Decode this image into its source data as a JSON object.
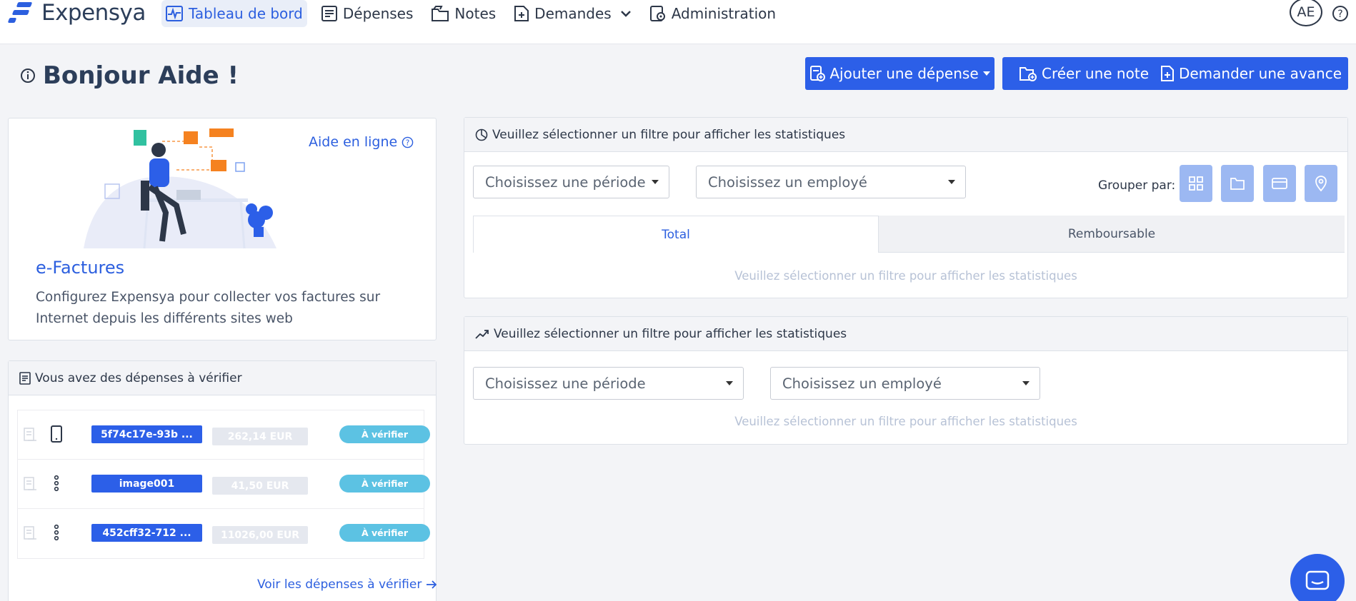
{
  "app": {
    "name": "Expensya"
  },
  "nav": {
    "items": [
      {
        "label": "Tableau de bord",
        "icon": "pulse-chart-icon",
        "active": true
      },
      {
        "label": "Dépenses",
        "icon": "receipt-icon",
        "active": false
      },
      {
        "label": "Notes",
        "icon": "folder-icon",
        "active": false
      },
      {
        "label": "Demandes",
        "icon": "file-plus-icon",
        "active": false,
        "dropdown": true
      },
      {
        "label": "Administration",
        "icon": "gear-doc-icon",
        "active": false
      }
    ],
    "user_initials": "AE"
  },
  "header": {
    "greeting": "Bonjour Aide !",
    "buttons": {
      "add_expense": "Ajouter une dépense",
      "create_note": "Créer une note",
      "request_advance": "Demander une avance"
    }
  },
  "promo": {
    "help_link": "Aide en ligne",
    "title": "e-Factures",
    "text": "Configurez Expensya pour collecter vos factures sur Internet depuis les différents sites web"
  },
  "verify": {
    "title": "Vous avez des dépenses à vérifier",
    "rows": [
      {
        "name": "5f74c17e-93b ...",
        "amount": "262,14 EUR",
        "status": "À vérifier",
        "kind": "tablet-icon"
      },
      {
        "name": "image001",
        "amount": "41,50 EUR",
        "status": "À vérifier",
        "kind": "more-vertical-icon"
      },
      {
        "name": "452cff32-712 ...",
        "amount": "11026,00 EUR",
        "status": "À vérifier",
        "kind": "more-vertical-icon"
      }
    ],
    "link": "Voir les dépenses à vérifier"
  },
  "stats1": {
    "title": "Veuillez sélectionner un filtre pour afficher les statistiques",
    "period_placeholder": "Choisissez une période",
    "employee_placeholder": "Choisissez un employé",
    "group_label": "Grouper par:",
    "tabs": {
      "total": "Total",
      "refundable": "Remboursable"
    },
    "empty": "Veuillez sélectionner un filtre pour afficher les statistiques"
  },
  "stats2": {
    "title": "Veuillez sélectionner un filtre pour afficher les statistiques",
    "period_placeholder": "Choisissez une période",
    "employee_placeholder": "Choisissez un employé",
    "empty": "Veuillez sélectionner un filtre pour afficher les statistiques"
  },
  "colors": {
    "primary": "#2c5fe8",
    "status": "#5cc2e3",
    "group_button": "#9cb8f2"
  }
}
